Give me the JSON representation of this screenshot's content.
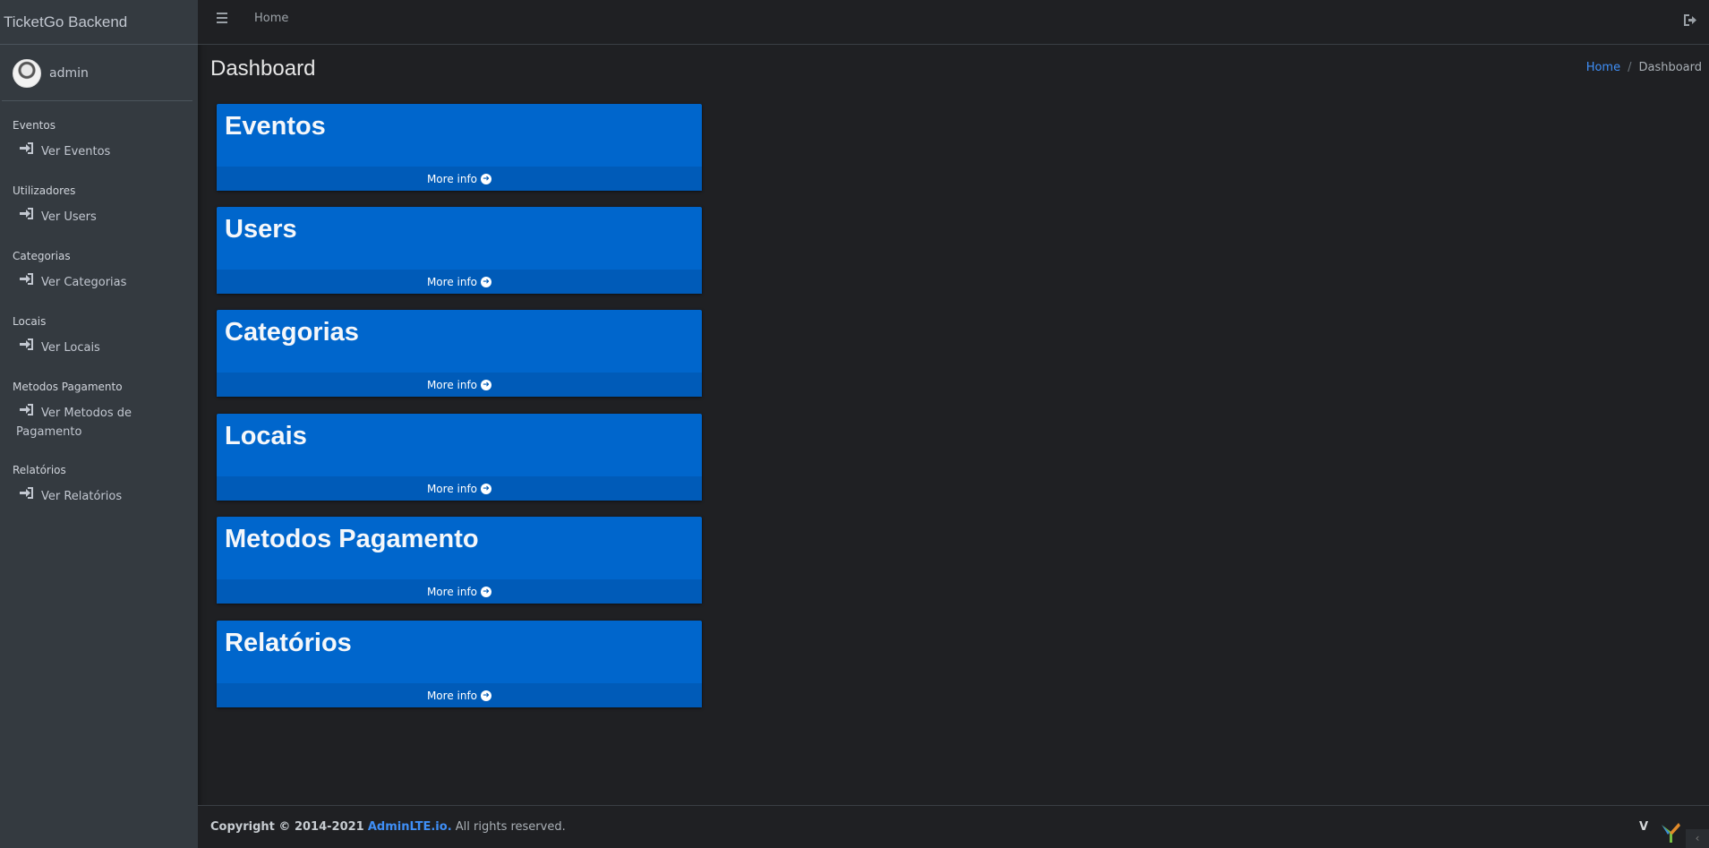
{
  "brand": {
    "title": "TicketGo Backend"
  },
  "user": {
    "name": "admin"
  },
  "sidebar": {
    "groups": [
      {
        "header": "Eventos",
        "item": "Ver Eventos"
      },
      {
        "header": "Utilizadores",
        "item": "Ver Users"
      },
      {
        "header": "Categorias",
        "item": "Ver Categorias"
      },
      {
        "header": "Locais",
        "item": "Ver Locais"
      },
      {
        "header": "Metodos Pagamento",
        "item_line1": "Ver Metodos de",
        "item_line2": "Pagamento"
      },
      {
        "header": "Relatórios",
        "item": "Ver Relatórios"
      }
    ]
  },
  "topbar": {
    "home": "Home"
  },
  "header": {
    "title": "Dashboard"
  },
  "breadcrumb": {
    "home": "Home",
    "separator": "/",
    "current": "Dashboard"
  },
  "cards": [
    {
      "title": "Eventos",
      "link": "More info"
    },
    {
      "title": "Users",
      "link": "More info"
    },
    {
      "title": "Categorias",
      "link": "More info"
    },
    {
      "title": "Locais",
      "link": "More info"
    },
    {
      "title": "Metodos Pagamento",
      "link": "More info"
    },
    {
      "title": "Relatórios",
      "link": "More info"
    }
  ],
  "footer": {
    "copyright_prefix": "Copyright © 2014-2021",
    "brand_link": "AdminLTE.io.",
    "rights": "All rights reserved.",
    "version_initial": "V"
  },
  "colors": {
    "card_bg": "#0066cc",
    "card_footer": "#005bb8",
    "sidebar_bg": "#343a40",
    "link": "#3f8ff7"
  },
  "icons": {
    "menu": "hamburger-icon",
    "logout": "sign-out-icon",
    "nav": "sign-in-icon",
    "card_arrow": "arrow-circle-right-icon"
  }
}
